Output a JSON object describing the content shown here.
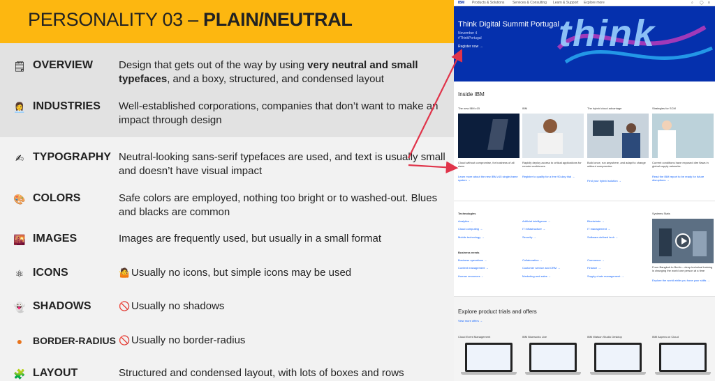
{
  "header": {
    "title_regular": "PERSONALITY 03 –",
    "title_bold": "PLAIN/NEUTRAL"
  },
  "rows": [
    {
      "icon": "notepad-icon",
      "glyph": "🗒",
      "label": "OVERVIEW",
      "desc_parts": [
        "Design that gets out of the way by using ",
        "very neutral and small typefaces",
        ", and a boxy, structured, and condensed layout"
      ]
    },
    {
      "icon": "office-worker-icon",
      "glyph": "👩‍💼",
      "label": "INDUSTRIES",
      "desc": "Well-established corporations, companies that don’t want to make an impact through design"
    },
    {
      "icon": "writing-hand-icon",
      "glyph": "✍",
      "label": "TYPOGRAPHY",
      "desc": "Neutral-looking sans-serif typefaces are used, and text is usually small and doesn’t have visual impact"
    },
    {
      "icon": "palette-icon",
      "glyph": "🎨",
      "label": "COLORS",
      "desc": "Safe colors are employed, nothing too bright or to washed-out. Blues and blacks are common"
    },
    {
      "icon": "sunset-image-icon",
      "glyph": "🌇",
      "label": "IMAGES",
      "desc": "Images are frequently used, but usually in a small format"
    },
    {
      "icon": "atom-icon",
      "glyph": "⚛",
      "label": "ICONS",
      "desc_icon": "shrug-icon",
      "desc_glyph": "🤷",
      "desc": "Usually no icons, but simple icons may be used"
    },
    {
      "icon": "ghost-icon",
      "glyph": "👻",
      "label": "SHADOWS",
      "desc_icon": "prohibited-icon",
      "desc_glyph": "🚫",
      "desc": "Usually no shadows"
    },
    {
      "icon": "orange-circle-icon",
      "glyph": "●",
      "label": "BORDER-RADIUS",
      "desc_icon": "prohibited-icon",
      "desc_glyph": "🚫",
      "desc": "Usually no border-radius"
    },
    {
      "icon": "puzzle-piece-icon",
      "glyph": "🧩",
      "label": "LAYOUT",
      "desc": "Structured and condensed layout, with lots of boxes and rows"
    }
  ],
  "shot": {
    "nav": [
      "IBM",
      "Products & Solutions",
      "Services & Consulting",
      "Learn & Support",
      "Explore more"
    ],
    "hero_title": "Think Digital Summit Portugal",
    "hero_date": "November 4",
    "hero_tag": "#ThinkPortugal",
    "hero_link": "Register now →",
    "hero_word": "think",
    "inside_title": "Inside IBM",
    "cards": [
      {
        "cap": "The new IBM z15",
        "body": "Cloud without compromise, for business of all sizes",
        "link": "Learn more about the new IBM z15 single-frame system →"
      },
      {
        "cap": "IBM",
        "body": "Rapidly deploy access to critical applications for remote workforces",
        "link": "Register to qualify for a free 90-day trial →"
      },
      {
        "cap": "The hybrid cloud advantage",
        "body": "Build once, run anywhere, and adapt to change without compromise",
        "link": "Find your hybrid solution →"
      },
      {
        "cap": "Strategies for SCM",
        "body": "Current conditions have exposed dire flaws in global supply networks.",
        "link": "Read the IBM report to be ready for future disruptions →"
      }
    ],
    "tech_title": "Technologies",
    "tech_links": [
      "Analytics →",
      "Artificial intelligence →",
      "Blockchain →",
      "Cloud computing →",
      "IT infrastructure →",
      "IT management →",
      "Mobile technology →",
      "Security →",
      "Software-defined tech →"
    ],
    "biz_title": "Business needs",
    "biz_links": [
      "Business operations →",
      "Collaboration →",
      "Commerce →",
      "Content management →",
      "Customer service and CRM →",
      "Finance →",
      "Human resources →",
      "Marketing and sales →",
      "Supply chain management →"
    ],
    "stories_title": "Systems Stats",
    "stories_body": "From Bangkok to Berlin – deep technical training is changing the world one person at a time",
    "stories_link": "Explore the world while you hone your skills →",
    "trials_title": "Explore product trials and offers",
    "trials_link": "View more offers →",
    "trials": [
      "Cloud Event Management",
      "IBM Blueworks Live",
      "IBM Watson Studio Desktop",
      "IBM Aspera on Cloud"
    ]
  },
  "colors": {
    "accent": "#fdb710",
    "hero": "#0530ad",
    "arrow": "#e0344a",
    "link": "#0f62fe"
  }
}
